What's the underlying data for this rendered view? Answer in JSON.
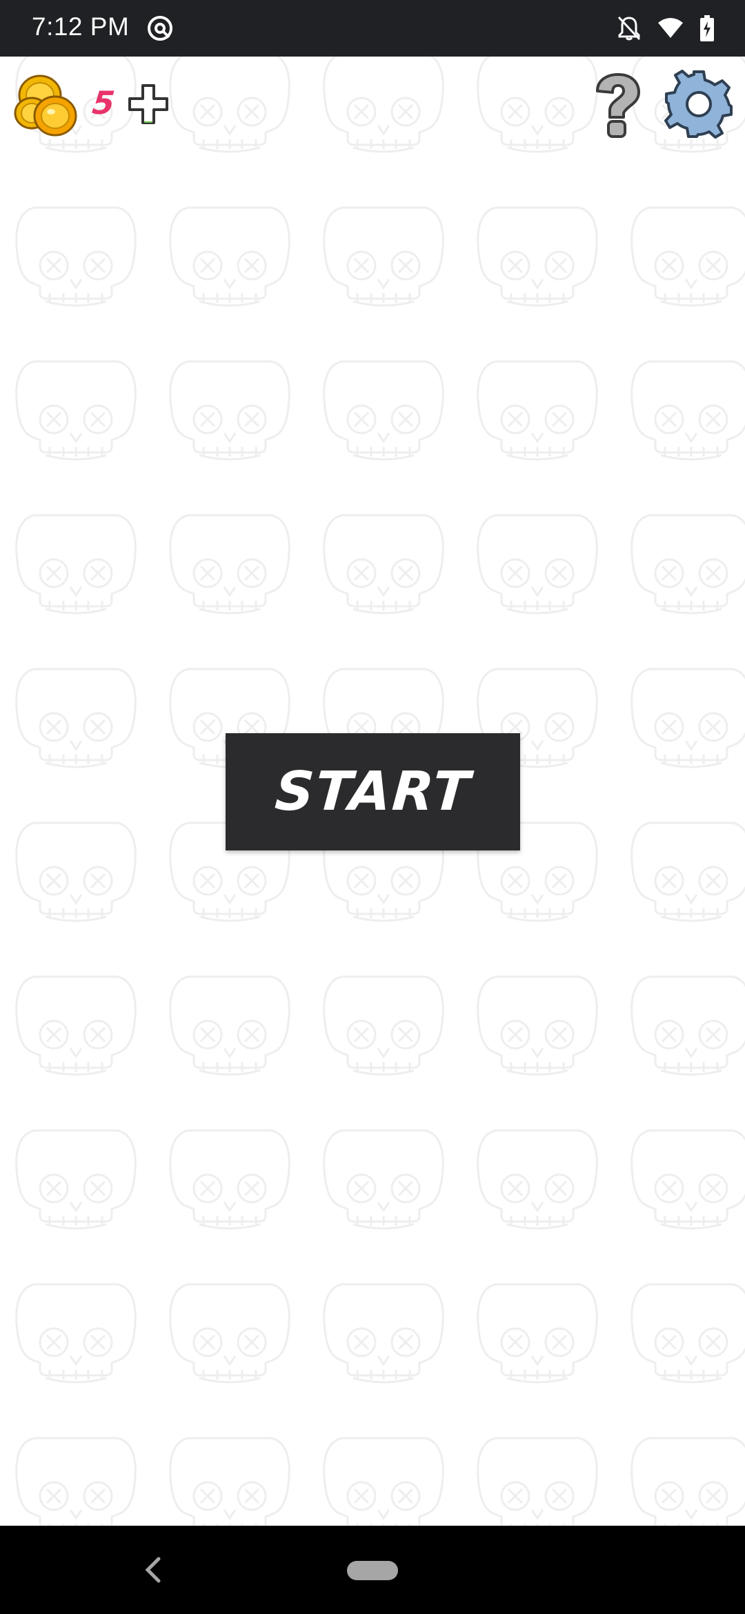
{
  "status_bar": {
    "time": "7:12 PM",
    "icons": [
      "app-notification-icon",
      "notifications-off-icon",
      "wifi-icon",
      "battery-charging-icon"
    ]
  },
  "hud": {
    "coin_count": "5",
    "coins_icon": "gold-coins-icon",
    "add_icon": "plus-icon",
    "help_icon": "question-mark-icon",
    "settings_icon": "gear-icon"
  },
  "main": {
    "start_label": "START"
  },
  "background": {
    "pattern_icon": "skull-icon"
  },
  "colors": {
    "status_bar_bg": "#202124",
    "coin_count": "#e8326a",
    "start_button_bg": "#2b2b2d",
    "nav_bar_bg": "#000000",
    "skull_outline": "#eeeeee"
  },
  "nav_bar": {
    "icons": [
      "back-icon",
      "home-pill-icon"
    ]
  }
}
